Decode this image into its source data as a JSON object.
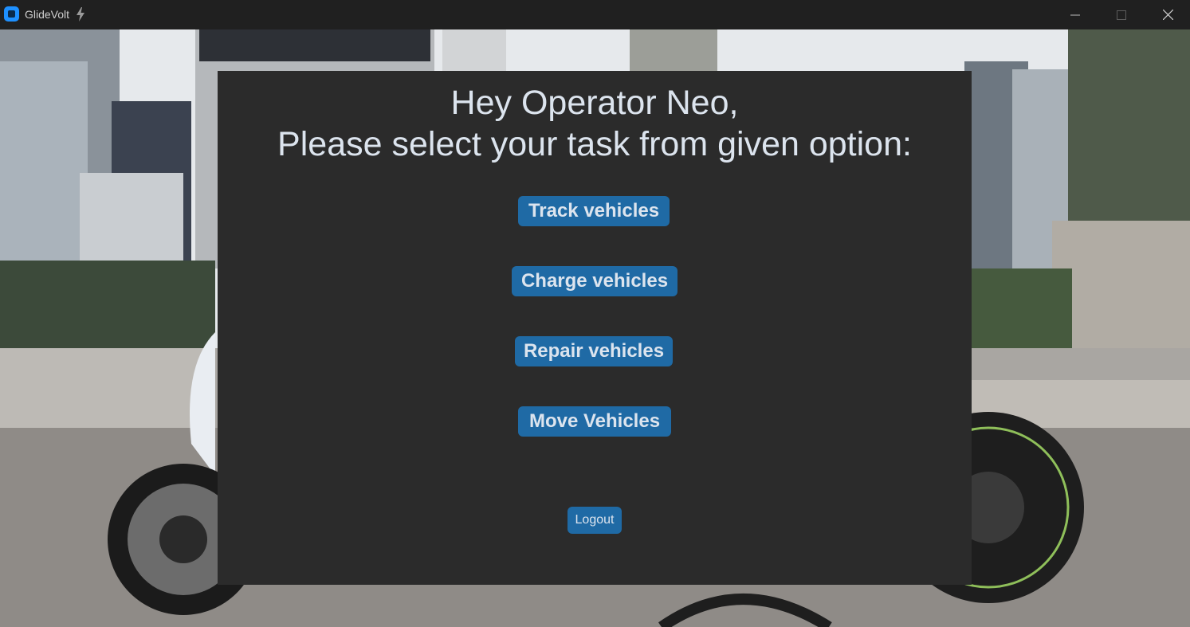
{
  "window": {
    "title": "GlideVolt",
    "icon": "app-icon",
    "controls": [
      "minimize-icon",
      "maximize-icon",
      "close-icon"
    ]
  },
  "main": {
    "greeting_line1": "Hey Operator Neo,",
    "greeting_line2": "Please select your task from given option:",
    "buttons": [
      {
        "label": "Track vehicles"
      },
      {
        "label": "Charge vehicles"
      },
      {
        "label": "Repair vehicles"
      },
      {
        "label": "Move Vehicles"
      }
    ],
    "logout_label": "Logout"
  },
  "colors": {
    "panel": "#2b2b2b",
    "button": "#1f6aa5",
    "text": "#dce4ee",
    "titlebar": "#202020"
  }
}
